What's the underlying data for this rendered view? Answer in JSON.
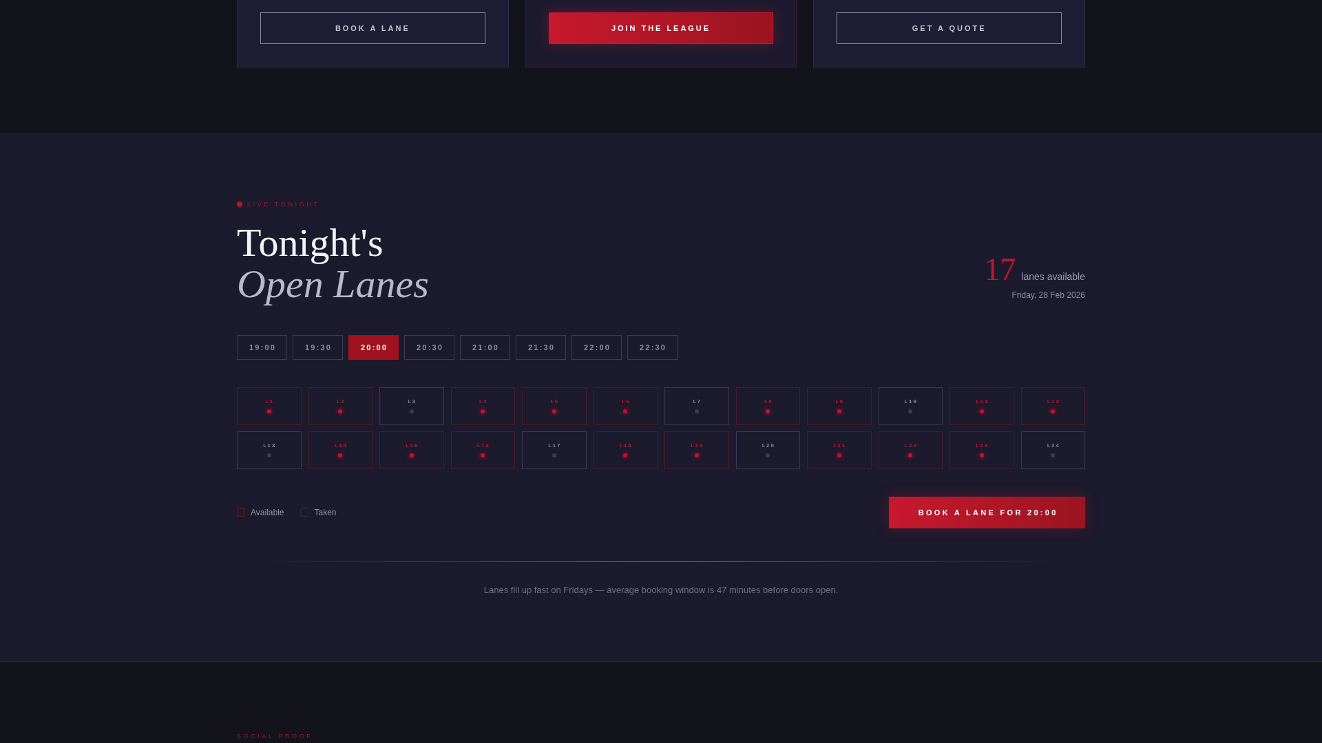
{
  "cta_cards": [
    {
      "button": "BOOK A LANE",
      "kind": "outline"
    },
    {
      "button": "JOIN THE LEAGUE",
      "kind": "primary"
    },
    {
      "button": "GET A QUOTE",
      "kind": "outline"
    }
  ],
  "lanes_section": {
    "eyebrow": "LIVE TONIGHT",
    "title_line_1": "Tonight's",
    "title_line_2": "Open Lanes",
    "count": "17",
    "count_label": "lanes available",
    "date": "Friday, 28 Feb 2026",
    "time_slots": [
      {
        "label": "19:00",
        "selected": false
      },
      {
        "label": "19:30",
        "selected": false
      },
      {
        "label": "20:00",
        "selected": true
      },
      {
        "label": "20:30",
        "selected": false
      },
      {
        "label": "21:00",
        "selected": false
      },
      {
        "label": "21:30",
        "selected": false
      },
      {
        "label": "22:00",
        "selected": false
      },
      {
        "label": "22:30",
        "selected": false
      }
    ],
    "lanes": [
      {
        "label": "L1",
        "available": true
      },
      {
        "label": "L2",
        "available": true
      },
      {
        "label": "L3",
        "available": false
      },
      {
        "label": "L4",
        "available": true
      },
      {
        "label": "L5",
        "available": true
      },
      {
        "label": "L6",
        "available": true
      },
      {
        "label": "L7",
        "available": false
      },
      {
        "label": "L8",
        "available": true
      },
      {
        "label": "L9",
        "available": true
      },
      {
        "label": "L10",
        "available": false
      },
      {
        "label": "L11",
        "available": true
      },
      {
        "label": "L12",
        "available": true
      },
      {
        "label": "L13",
        "available": false
      },
      {
        "label": "L14",
        "available": true
      },
      {
        "label": "L15",
        "available": true
      },
      {
        "label": "L16",
        "available": true
      },
      {
        "label": "L17",
        "available": false
      },
      {
        "label": "L18",
        "available": true
      },
      {
        "label": "L19",
        "available": true
      },
      {
        "label": "L20",
        "available": false
      },
      {
        "label": "L21",
        "available": true
      },
      {
        "label": "L22",
        "available": true
      },
      {
        "label": "L23",
        "available": true
      },
      {
        "label": "L24",
        "available": false
      }
    ],
    "legend": [
      {
        "label": "Available",
        "kind": "available"
      },
      {
        "label": "Taken",
        "kind": "taken"
      }
    ],
    "book_button": "BOOK A LANE FOR 20:00",
    "note": "Lanes fill up fast on Fridays — average booking window is 47 minutes before doors open."
  },
  "next_section": {
    "eyebrow": "SOCIAL PROOF"
  }
}
